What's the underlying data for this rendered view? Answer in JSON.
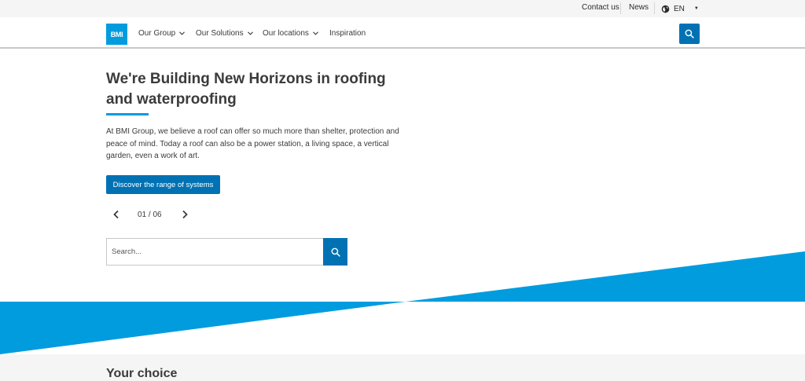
{
  "utility": {
    "contact_label": "Contact us",
    "news_label": "News",
    "language_label": "EN",
    "language_icon": "globe-icon"
  },
  "nav": {
    "logo_text": "BMI",
    "items": [
      {
        "label": "Our Group",
        "has_dropdown": true
      },
      {
        "label": "Our Solutions",
        "has_dropdown": true
      },
      {
        "label": "Our locations",
        "has_dropdown": true
      },
      {
        "label": "Inspiration",
        "has_dropdown": false
      }
    ],
    "search_icon": "search-icon"
  },
  "hero": {
    "title": "We're Building New Horizons in roofing and waterproofing",
    "body": "At BMI Group, we believe a roof can offer so much more than shelter, protection and peace of mind. Today a roof can also be a power station, a living space, a vertical garden, even a work of art.",
    "cta_label": "Discover the range of systems",
    "pager": {
      "current": "01",
      "total": "06",
      "text": "01 / 06"
    }
  },
  "search": {
    "placeholder": "Search...",
    "value": ""
  },
  "section": {
    "title": "Your choice"
  },
  "colors": {
    "brand_blue": "#019cde",
    "button_blue": "#0072b4",
    "text": "#3b3b3b",
    "utility_bg": "#f5f5f5"
  }
}
